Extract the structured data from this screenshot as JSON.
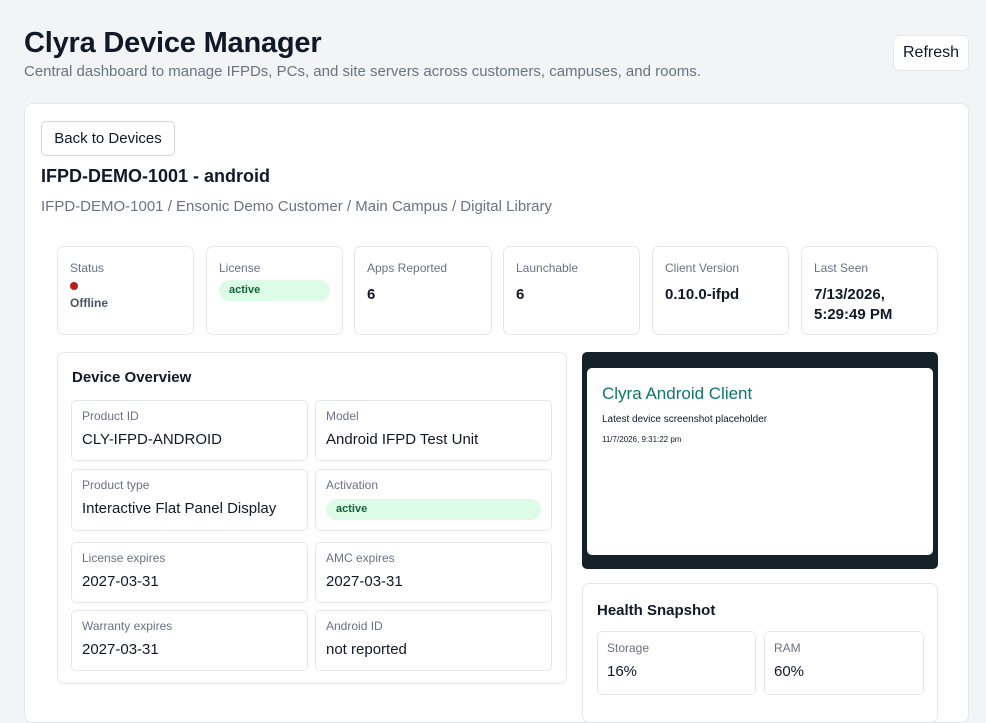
{
  "header": {
    "title": "Clyra Device Manager",
    "subtitle": "Central dashboard to manage IFPDs, PCs, and site servers across customers, campuses, and rooms.",
    "refresh_label": "Refresh"
  },
  "device": {
    "back_label": "Back to Devices",
    "title": "IFPD-DEMO-1001 - android",
    "breadcrumb": "IFPD-DEMO-1001 / Ensonic Demo Customer / Main Campus / Digital Library"
  },
  "stats": {
    "status": {
      "label": "Status",
      "value": "Offline",
      "dot_color": "#b91c1c"
    },
    "license": {
      "label": "License",
      "value": "active"
    },
    "apps_reported": {
      "label": "Apps Reported",
      "value": "6"
    },
    "launchable": {
      "label": "Launchable",
      "value": "6"
    },
    "client_version": {
      "label": "Client Version",
      "value": "0.10.0-ifpd"
    },
    "last_seen": {
      "label": "Last Seen",
      "value": "7/13/2026, 5:29:49 PM"
    }
  },
  "overview": {
    "title": "Device Overview",
    "fields": {
      "product_id": {
        "label": "Product ID",
        "value": "CLY-IFPD-ANDROID"
      },
      "model": {
        "label": "Model",
        "value": "Android IFPD Test Unit"
      },
      "product_type": {
        "label": "Product type",
        "value": "Interactive Flat Panel Display"
      },
      "activation": {
        "label": "Activation",
        "value": "active"
      },
      "license_expires": {
        "label": "License expires",
        "value": "2027-03-31"
      },
      "amc_expires": {
        "label": "AMC expires",
        "value": "2027-03-31"
      },
      "warranty_expires": {
        "label": "Warranty expires",
        "value": "2027-03-31"
      },
      "android_id": {
        "label": "Android ID",
        "value": "not reported"
      }
    }
  },
  "screenshot": {
    "title": "Clyra Android Client",
    "subtitle": "Latest device screenshot placeholder",
    "timestamp": "11/7/2026, 9:31:22 pm"
  },
  "health": {
    "title": "Health Snapshot",
    "storage": {
      "label": "Storage",
      "value": "16%"
    },
    "ram": {
      "label": "RAM",
      "value": "60%"
    }
  },
  "colors": {
    "accent_teal": "#0f766e",
    "active_pill_bg": "#dcfce7",
    "active_pill_text": "#166534",
    "offline_red": "#b91c1c"
  }
}
